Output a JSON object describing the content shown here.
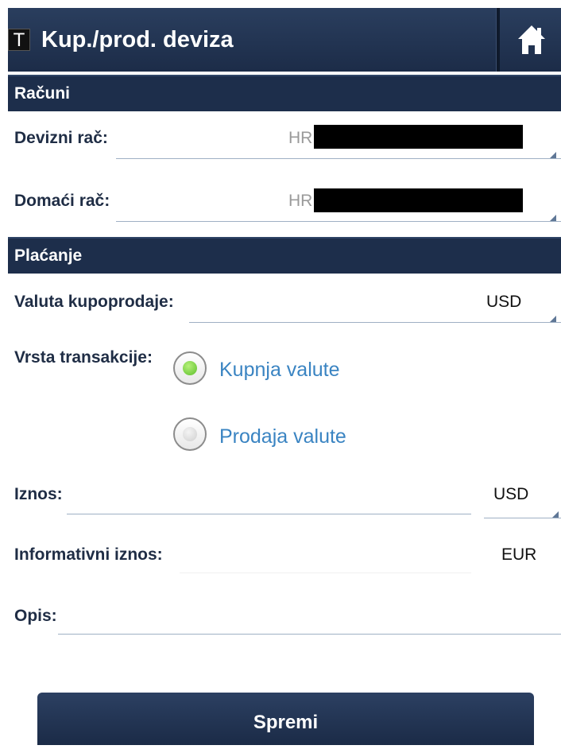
{
  "header": {
    "app_icon_letter": "T",
    "title": "Kup./prod. deviza",
    "home_icon": "home-icon"
  },
  "sections": {
    "accounts": "Računi",
    "payment": "Plaćanje"
  },
  "accounts": {
    "foreign_label": "Devizni rač:",
    "foreign_prefix": "HR",
    "domestic_label": "Domaći rač:",
    "domestic_prefix": "HR"
  },
  "payment": {
    "currency_label": "Valuta kupoprodaje:",
    "currency_value": "USD",
    "transaction_type_label": "Vrsta transakcije:",
    "options": [
      {
        "label": "Kupnja valute",
        "selected": true
      },
      {
        "label": "Prodaja valute",
        "selected": false
      }
    ],
    "amount_label": "Iznos:",
    "amount_currency": "USD",
    "info_amount_label": "Informativni iznos:",
    "info_amount_currency": "EUR",
    "description_label": "Opis:"
  },
  "actions": {
    "save_label": "Spremi"
  },
  "colors": {
    "header_bg": "#1d2e4b",
    "link_blue": "#3a84c2",
    "radio_selected": "#7fd44a"
  }
}
